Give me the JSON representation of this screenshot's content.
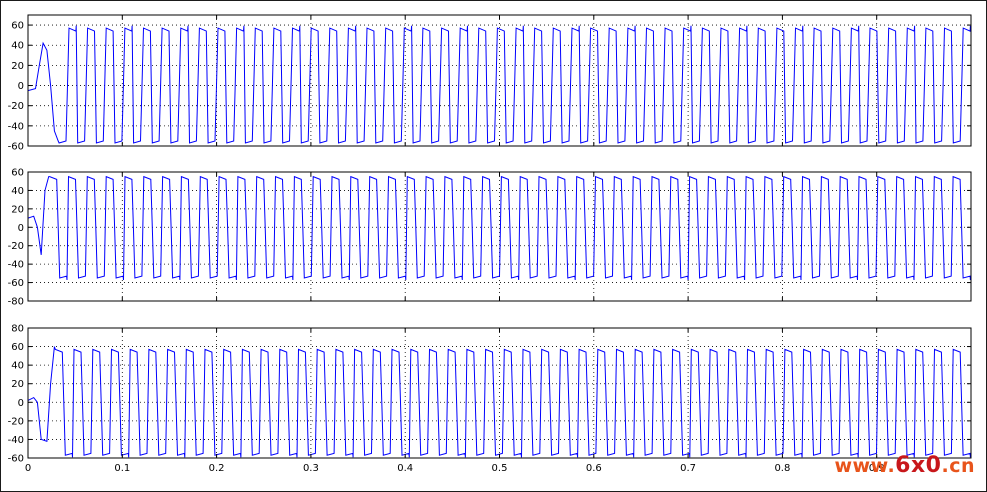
{
  "chart_data": [
    {
      "type": "line",
      "title": "",
      "xlabel": "",
      "ylabel": "",
      "xlim": [
        0,
        1.0
      ],
      "ylim": [
        -60,
        70
      ],
      "yticks": [
        -60,
        -40,
        -20,
        0,
        20,
        40,
        60
      ],
      "xticks": [
        0,
        0.1,
        0.2,
        0.3,
        0.4,
        0.5,
        0.6,
        0.7,
        0.8,
        0.9,
        1.0
      ],
      "xtick_labels": [],
      "grid": true,
      "series": [
        {
          "color": "#0000ff",
          "waveform": "square-like",
          "high": 57,
          "low": -57,
          "cycles": 49,
          "x_start": 0.0,
          "x_end": 1.0,
          "startup": [
            [
              0.0,
              -5
            ],
            [
              0.008,
              -3
            ],
            [
              0.012,
              20
            ],
            [
              0.016,
              42
            ],
            [
              0.02,
              35
            ],
            [
              0.024,
              0
            ],
            [
              0.028,
              -45
            ],
            [
              0.032,
              -55
            ]
          ]
        }
      ]
    },
    {
      "type": "line",
      "title": "",
      "xlabel": "",
      "ylabel": "",
      "xlim": [
        0,
        1.0
      ],
      "ylim": [
        -80,
        60
      ],
      "yticks": [
        -80,
        -60,
        -40,
        -20,
        0,
        20,
        40,
        60
      ],
      "xticks": [
        0,
        0.1,
        0.2,
        0.3,
        0.4,
        0.5,
        0.6,
        0.7,
        0.8,
        0.9,
        1.0
      ],
      "xtick_labels": [],
      "grid": true,
      "series": [
        {
          "color": "#0000ff",
          "waveform": "square-like",
          "high": 55,
          "low": -55,
          "cycles": 49,
          "x_start": 0.0,
          "x_end": 1.0,
          "startup": [
            [
              0.0,
              10
            ],
            [
              0.006,
              12
            ],
            [
              0.01,
              0
            ],
            [
              0.014,
              -30
            ],
            [
              0.018,
              40
            ],
            [
              0.022,
              55
            ]
          ]
        }
      ]
    },
    {
      "type": "line",
      "title": "",
      "xlabel": "",
      "ylabel": "",
      "xlim": [
        0,
        1.0
      ],
      "ylim": [
        -60,
        80
      ],
      "yticks": [
        -60,
        -40,
        -20,
        0,
        20,
        40,
        60,
        80
      ],
      "xticks": [
        0,
        0.1,
        0.2,
        0.3,
        0.4,
        0.5,
        0.6,
        0.7,
        0.8,
        0.9,
        1.0
      ],
      "xtick_labels": [
        "0",
        "0.1",
        "0.2",
        "0.3",
        "0.4",
        "0.5",
        "0.6",
        "0.7",
        "0.8",
        "0.9",
        ""
      ],
      "grid": true,
      "series": [
        {
          "color": "#0000ff",
          "waveform": "square-like",
          "high": 57,
          "low": -57,
          "cycles": 49,
          "x_start": 0.0,
          "x_end": 1.0,
          "startup": [
            [
              0.0,
              2
            ],
            [
              0.006,
              5
            ],
            [
              0.01,
              0
            ],
            [
              0.014,
              -40
            ],
            [
              0.02,
              -42
            ],
            [
              0.024,
              20
            ],
            [
              0.028,
              60
            ]
          ]
        }
      ]
    }
  ],
  "watermark": {
    "prefix": "www.",
    "big": "6x0",
    "suffix": ".cn"
  }
}
